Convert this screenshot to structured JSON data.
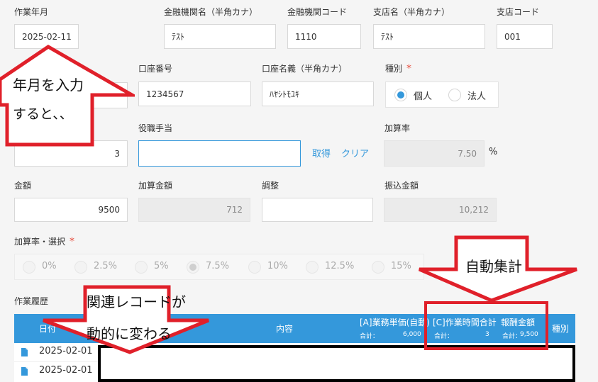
{
  "form": {
    "row1": {
      "work_month_label": "作業年月",
      "work_month_value": "2025-02-11",
      "bank_name_label": "金融機関名（半角カナ）",
      "bank_name_value": "ﾃｽﾄ",
      "bank_code_label": "金融機関コード",
      "bank_code_value": "1110",
      "branch_name_label": "支店名（半角カナ）",
      "branch_name_value": "ﾃｽﾄ",
      "branch_code_label": "支店コード",
      "branch_code_value": "001"
    },
    "row2": {
      "account_no_label": "口座番号",
      "account_no_value": "1234567",
      "account_name_label": "口座名義（半角カナ）",
      "account_name_value": "ﾊﾔｼﾄﾓﾕｷ",
      "type_label": "種別",
      "type_required": "*",
      "type_options": [
        "個人",
        "法人"
      ],
      "type_selected": "個人"
    },
    "row3": {
      "left_value": "3",
      "allowance_label": "役職手当",
      "allowance_value": "",
      "get_link": "取得",
      "clear_link": "クリア",
      "rate_label": "加算率",
      "rate_value": "7.50",
      "rate_unit": "%"
    },
    "row4": {
      "amount_label": "金額",
      "amount_value": "9500",
      "add_amount_label": "加算金額",
      "add_amount_value": "712",
      "adjust_label": "調整",
      "adjust_value": "",
      "transfer_label": "振込金額",
      "transfer_value": "10,212"
    },
    "rate_select": {
      "label": "加算率・選択",
      "required": "*",
      "options": [
        "0%",
        "2.5%",
        "5%",
        "7.5%",
        "10%",
        "12.5%",
        "15%"
      ],
      "selected": "7.5%"
    }
  },
  "history": {
    "title": "作業履歴",
    "columns": {
      "date": "日付",
      "content": "内容",
      "unit_price": "[A]業務単価(自動)",
      "unit_price_total_label": "合計：",
      "unit_price_total": "6,000",
      "work_hours": "[C]作業時間合計",
      "work_hours_total_label": "合計：",
      "work_hours_total": "3",
      "reward": "報酬金額",
      "reward_total_label": "合計：",
      "reward_total": "9,500",
      "type": "種別"
    },
    "rows": [
      {
        "date": "2025-02-01"
      },
      {
        "date": "2025-02-01"
      }
    ]
  },
  "annotations": {
    "callout1_line1": "年月を入力",
    "callout1_line2": "すると、、",
    "callout2": "自動集計",
    "callout3_line1": "関連レコードが",
    "callout3_line2": "動的に変わる"
  },
  "colors": {
    "accent": "#3498db",
    "annotation_red": "#e0202a",
    "required": "#e74c3c"
  }
}
